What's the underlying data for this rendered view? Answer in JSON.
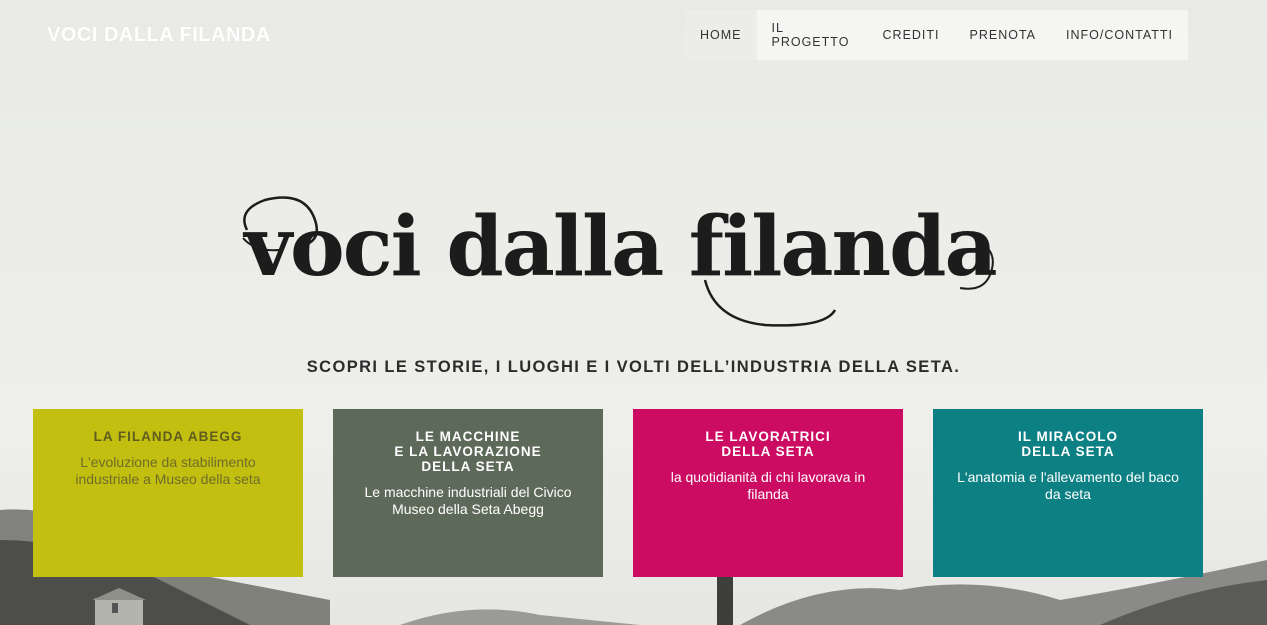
{
  "header": {
    "site_title": "VOCI DALLA FILANDA",
    "nav": [
      {
        "label": "HOME",
        "active": true
      },
      {
        "label": "IL PROGETTO"
      },
      {
        "label": "CREDITI"
      },
      {
        "label": "PRENOTA"
      },
      {
        "label": "INFO/CONTATTI"
      }
    ]
  },
  "hero": {
    "logo_text": "voci dalla filanda",
    "tagline": "SCOPRI LE STORIE, I LUOGHI E I VOLTI DELL’INDUSTRIA DELLA SETA."
  },
  "cards": [
    {
      "title": "LA FILANDA ABEGG",
      "text": "L'evoluzione da stabilimento industriale a Museo della seta",
      "color": "#c2bf10"
    },
    {
      "title": "LE MACCHINE\nE LA LAVORAZIONE\nDELLA SETA",
      "text": "Le macchine industriali del Civico Museo della Seta Abegg",
      "color": "#5e6a59"
    },
    {
      "title": "LE LAVORATRICI\nDELLA SETA",
      "text": "la quotidianità di chi lavorava in filanda",
      "color": "#cc0c63"
    },
    {
      "title": "IL MIRACOLO\nDELLA SETA",
      "text": "L'anatomia e l'allevamento del baco da seta",
      "color": "#0c8083"
    }
  ]
}
